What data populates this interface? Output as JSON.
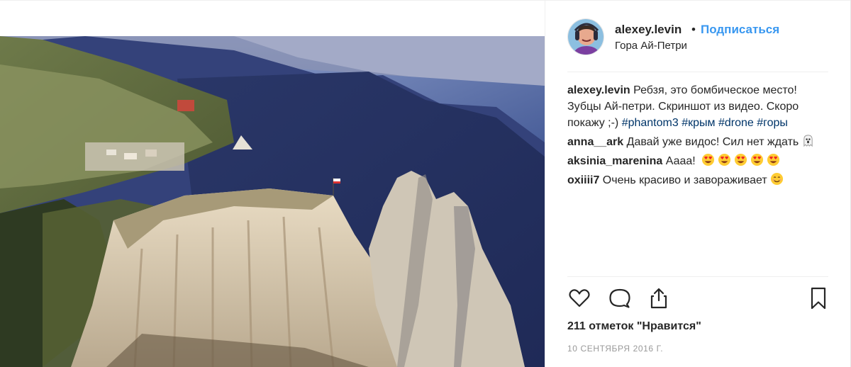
{
  "post": {
    "username": "alexey.levin",
    "follow_label": "Подписаться",
    "location": "Гора Ай-Петри",
    "photo_icon": "landscape-photo",
    "likes_text": "211 отметок \"Нравится\"",
    "date_text": "10 СЕНТЯБРЯ 2016 Г."
  },
  "caption": {
    "username": "alexey.levin",
    "text": " Ребзя, это бомбическое место!Зубцы Ай-петри. Скриншот из видео. Скоро покажу ;-) ",
    "hashtags": [
      "#phantom3",
      "#крым",
      "#drone",
      "#горы"
    ]
  },
  "comments": [
    {
      "username": "anna__ark",
      "text": " Давай уже видос! Сил нет ждать",
      "emoji": [
        "ghost-emoji"
      ]
    },
    {
      "username": "aksinia_marenina",
      "text": " Аааа!",
      "emoji": [
        "heart-eyes-emoji",
        "heart-eyes-emoji",
        "heart-eyes-emoji",
        "heart-eyes-emoji",
        "heart-eyes-emoji"
      ]
    },
    {
      "username": "oxiiii7",
      "text": " Очень красиво и завораживает",
      "emoji": [
        "smiling-emoji"
      ]
    }
  ],
  "actions": {
    "like_icon": "heart-outline-icon",
    "comment_icon": "comment-bubble-icon",
    "share_icon": "share-icon",
    "save_icon": "bookmark-icon"
  },
  "colors": {
    "link_blue": "#3897f0",
    "hashtag": "#003569",
    "muted": "#999999",
    "text": "#262626"
  }
}
